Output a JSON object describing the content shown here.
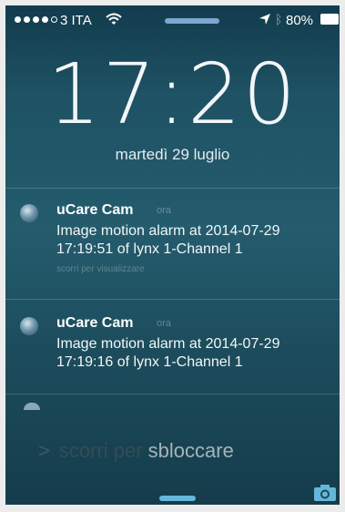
{
  "status_bar": {
    "carrier": "3 ITA",
    "battery": "80%"
  },
  "lock_screen": {
    "time": "17:20",
    "date": "martedì 29 luglio",
    "slide_prefix": "scorri per",
    "slide_highlight": "sbloccare"
  },
  "notifications": [
    {
      "app": "uCare Cam",
      "time": "ora",
      "body_line1": "Image motion alarm at 2014-07-29",
      "body_line2": "17:19:51 of lynx 1-Channel 1",
      "hint": "scorri per visualizzare"
    },
    {
      "app": "uCare Cam",
      "time": "ora",
      "body_line1": "Image motion alarm at 2014-07-29",
      "body_line2": "17:19:16 of lynx 1-Channel 1"
    }
  ],
  "icons": {
    "signal": "signal-dots-icon",
    "wifi": "wifi-icon",
    "location": "location-arrow-icon",
    "bluetooth": "bluetooth-icon",
    "battery": "battery-icon",
    "app": "ucare-cam-app-icon",
    "camera": "camera-icon"
  },
  "colors": {
    "accent": "#65b7d9"
  }
}
